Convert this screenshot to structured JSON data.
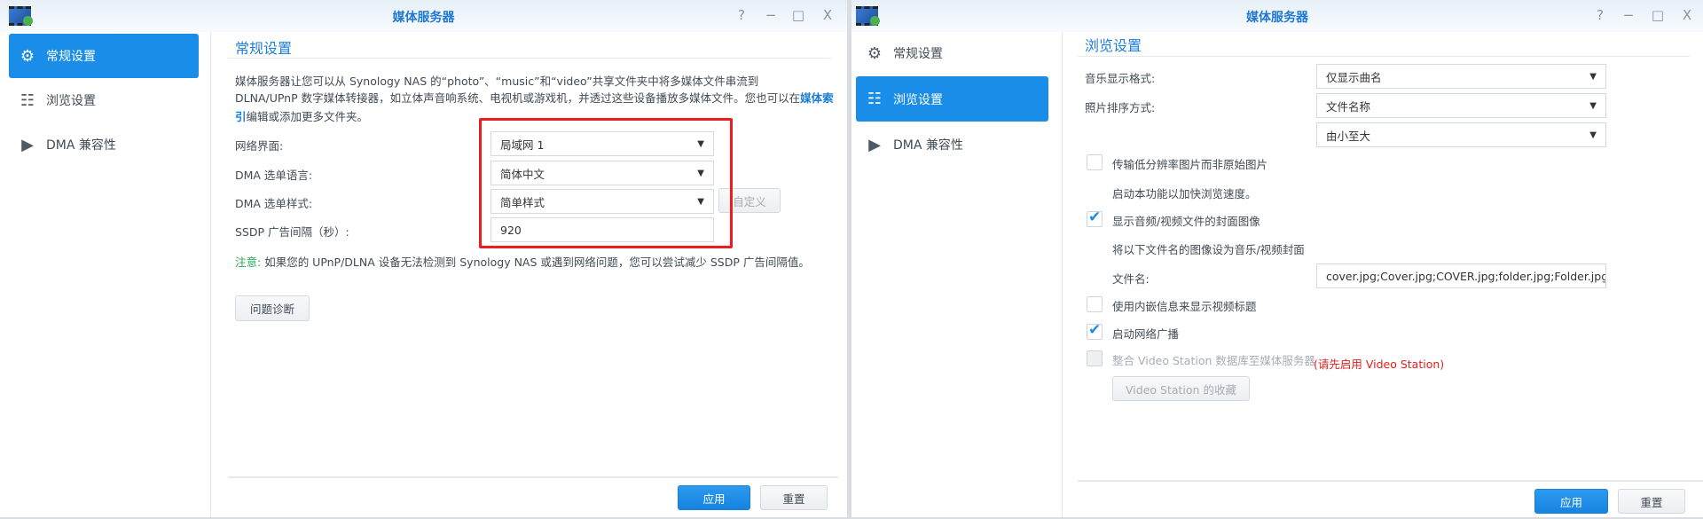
{
  "left_window": {
    "title": "媒体服务器",
    "controls": {
      "help": "?",
      "minimize": "−",
      "maximize": "□",
      "close": "X"
    },
    "sidebar": [
      {
        "label": "常规设置",
        "icon": "gear-icon"
      },
      {
        "label": "浏览设置",
        "icon": "list-icon"
      },
      {
        "label": "DMA 兼容性",
        "icon": "play-icon"
      }
    ],
    "section_title": "常规设置",
    "description": {
      "line1": "媒体服务器让您可以从 Synology NAS 的“photo”、“music”和“video”共享文件夹中将多媒体文件串流到",
      "line2_pre": "DLNA/UPnP 数字媒体转接器，如立体声音响系统、电视机或游戏机，并透过这些设备播放多媒体文件。您也可以在",
      "link_part1": "媒体索",
      "link_part2": "引",
      "line3_post": "编辑或添加更多文件夹。"
    },
    "fields": {
      "network_label": "网络界面:",
      "network_value": "局域网 1",
      "lang_label": "DMA 选单语言:",
      "lang_value": "简体中文",
      "style_label": "DMA 选单样式:",
      "style_value": "简单样式",
      "custom_button": "自定义",
      "ssdp_label": "SSDP 广告间隔（秒）:",
      "ssdp_value": "920"
    },
    "note": {
      "prefix": "注意:",
      "text": " 如果您的 UPnP/DLNA 设备无法检测到 Synology NAS 或遇到网络问题，您可以尝试减少 SSDP 广告间隔值。"
    },
    "diagnose_button": "问题诊断",
    "apply_button": "应用",
    "reset_button": "重置"
  },
  "right_window": {
    "title": "媒体服务器",
    "controls": {
      "help": "?",
      "minimize": "−",
      "maximize": "□",
      "close": "X"
    },
    "sidebar": [
      {
        "label": "常规设置",
        "icon": "gear-icon"
      },
      {
        "label": "浏览设置",
        "icon": "list-icon"
      },
      {
        "label": "DMA 兼容性",
        "icon": "play-icon"
      }
    ],
    "section_title": "浏览设置",
    "music_format_label": "音乐显示格式:",
    "music_format_value": "仅显示曲名",
    "photo_sort_label": "照片排序方式:",
    "photo_sort_value": "文件名称",
    "photo_order_value": "由小至大",
    "low_res": {
      "label": "传输低分辨率图片而非原始图片",
      "checked": false,
      "hint": "启动本功能以加快浏览速度。"
    },
    "cover": {
      "label": "显示音频/视频文件的封面图像",
      "checked": true,
      "hint": "将以下文件名的图像设为音乐/视频封面",
      "filename_label": "文件名:",
      "filename_value": "cover.jpg;Cover.jpg;COVER.jpg;folder.jpg;Folder.jpg;"
    },
    "embedded_title": {
      "label": "使用内嵌信息来显示视频标题",
      "checked": false
    },
    "broadcast": {
      "label": "启动网络广播",
      "checked": true
    },
    "video_station": {
      "label": "整合 Video Station 数据库至媒体服务器",
      "checked": false,
      "warning": "(请先启用 Video Station)",
      "favorites_button": "Video Station 的收藏"
    },
    "apply_button": "应用",
    "reset_button": "重置"
  }
}
